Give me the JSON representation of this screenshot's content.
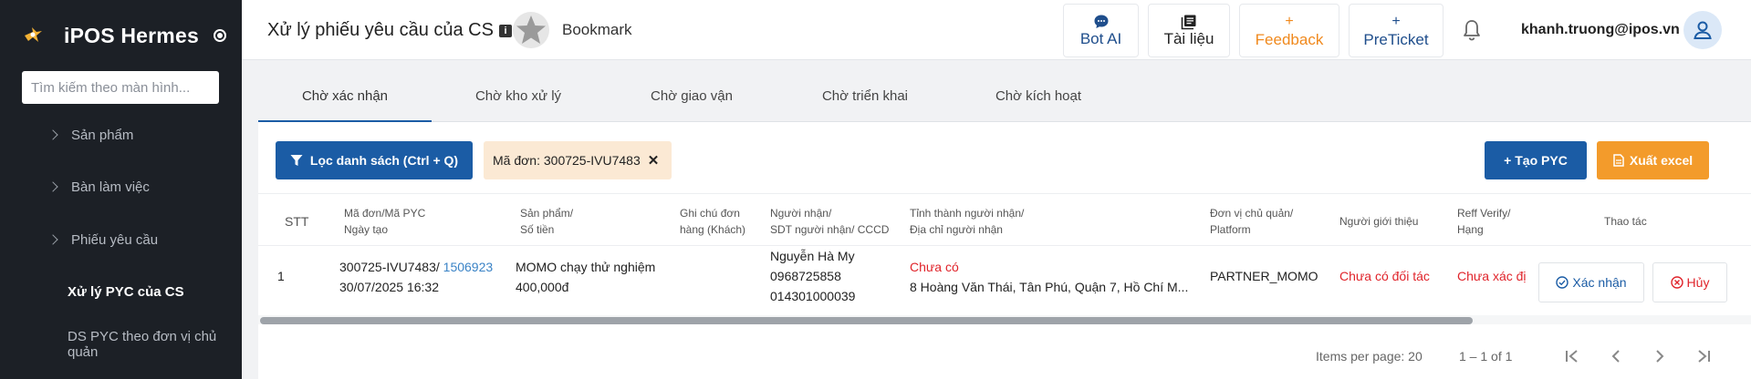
{
  "sidebar": {
    "brand": "iPOS Hermes",
    "search_placeholder": "Tìm kiếm theo màn hình...",
    "items": [
      {
        "label": "Sản phẩm"
      },
      {
        "label": "Bàn làm việc"
      },
      {
        "label": "Phiếu yêu cầu"
      },
      {
        "label": "Xử lý PYC của CS"
      },
      {
        "label": "DS PYC theo đơn vị chủ quản"
      }
    ]
  },
  "header": {
    "title": "Xử lý phiếu yêu cầu của CS",
    "bookmark": "Bookmark",
    "buttons": {
      "bot_ai": "Bot AI",
      "docs": "Tài liệu",
      "feedback": "Feedback",
      "preticket": "PreTicket"
    },
    "user_email": "khanh.truong@ipos.vn"
  },
  "tabs": [
    "Chờ xác nhận",
    "Chờ kho xử lý",
    "Chờ giao vận",
    "Chờ triển khai",
    "Chờ kích hoạt"
  ],
  "toolbar": {
    "filter_label": "Lọc danh sách (Ctrl + Q)",
    "chip_label": "Mã đơn: 300725-IVU7483",
    "create_label": "Tạo PYC",
    "excel_label": "Xuất excel"
  },
  "table": {
    "headers": {
      "stt": "STT",
      "order_1": "Mã đơn/Mã PYC",
      "order_2": "Ngày tạo",
      "product_1": "Sản phẩm/",
      "product_2": "Số tiền",
      "note_1": "Ghi chú đơn",
      "note_2": "hàng (Khách)",
      "recipient_1": "Người nhận/",
      "recipient_2": "SDT người nhận/ CCCD",
      "address_1": "Tỉnh thành người nhận/",
      "address_2": "Địa chỉ người nhận",
      "unit_1": "Đơn vị chủ quản/",
      "unit_2": "Platform",
      "referrer": "Người giới thiệu",
      "reff_1": "Reff Verify/",
      "reff_2": "Hạng",
      "actions": "Thao tác"
    },
    "rows": [
      {
        "stt": "1",
        "order_code": "300725-IVU7483/",
        "pyc_code": "1506923",
        "created": "30/07/2025 16:32",
        "product": "MOMO chạy thử nghiệm",
        "amount": "400,000đ",
        "recipient_name": "Nguyễn Hà My",
        "recipient_phone": "0968725858",
        "recipient_id": "014301000039",
        "province": "Chưa có",
        "address": "8 Hoàng Văn Thái, Tân Phú, Quận 7, Hồ Chí M...",
        "unit": "PARTNER_MOMO",
        "referrer": "Chưa có đối tác",
        "reff": "Chưa xác đị",
        "confirm_label": "Xác nhận",
        "cancel_label": "Hủy"
      }
    ]
  },
  "pagination": {
    "items_per_page": "Items per page: 20",
    "range": "1 – 1 of 1"
  },
  "colors": {
    "primary": "#1b5ca5",
    "accent_orange": "#f39b2b",
    "danger": "#e0242b",
    "sidebar_bg": "#1c2026"
  }
}
